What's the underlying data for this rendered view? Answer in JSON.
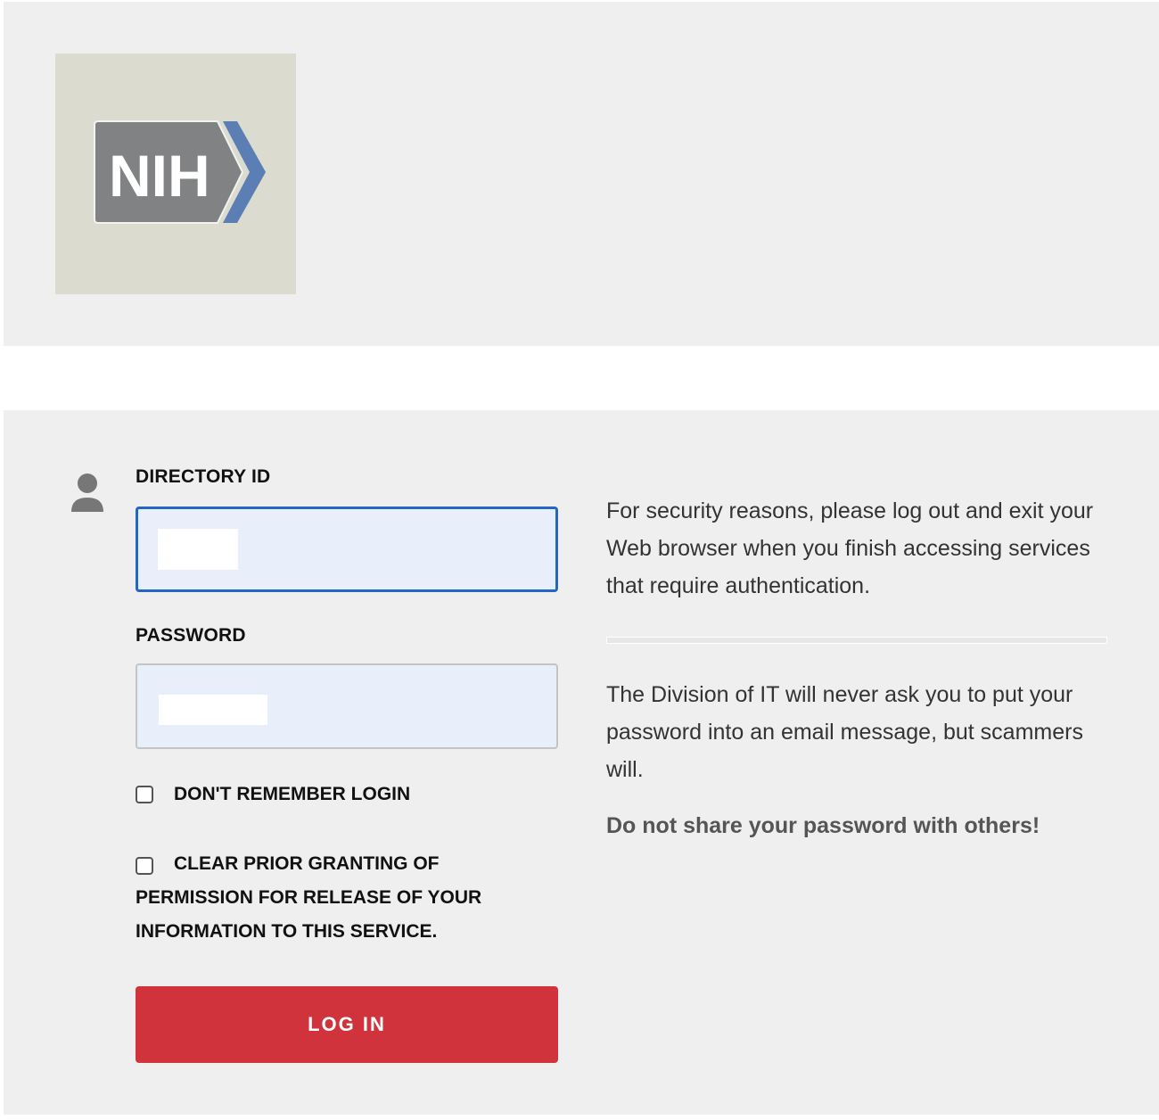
{
  "logo": {
    "text": "NIH",
    "colors": {
      "box": "#dbdbd0",
      "badge": "#808284",
      "chevron": "#5b7fb5"
    }
  },
  "form": {
    "user_icon": "user-icon",
    "directory_id_label": "DIRECTORY ID",
    "directory_id_value": "",
    "password_label": "PASSWORD",
    "password_value": "",
    "dont_remember_label": "DON'T REMEMBER LOGIN",
    "dont_remember_checked": false,
    "clear_permission_label_line1": "CLEAR PRIOR GRANTING OF",
    "clear_permission_label_line2": "PERMISSION FOR RELEASE OF YOUR",
    "clear_permission_label_line3": "INFORMATION TO THIS SERVICE.",
    "clear_permission_checked": false,
    "login_button": "LOG IN"
  },
  "info": {
    "security_line1": "For security reasons, please log out and exit your",
    "security_line2": "Web browser when you finish accessing services",
    "security_line3": "that require authentication.",
    "division_line1": "The Division of IT will never ask you to put your",
    "division_line2": "password into an email message, but scammers",
    "division_line3": "will.",
    "warning": "Do not share your password with others!"
  },
  "colors": {
    "accent": "#2566c0",
    "button": "#d0333b",
    "panel_bg": "#efefef",
    "input_bg": "#e8effb"
  }
}
